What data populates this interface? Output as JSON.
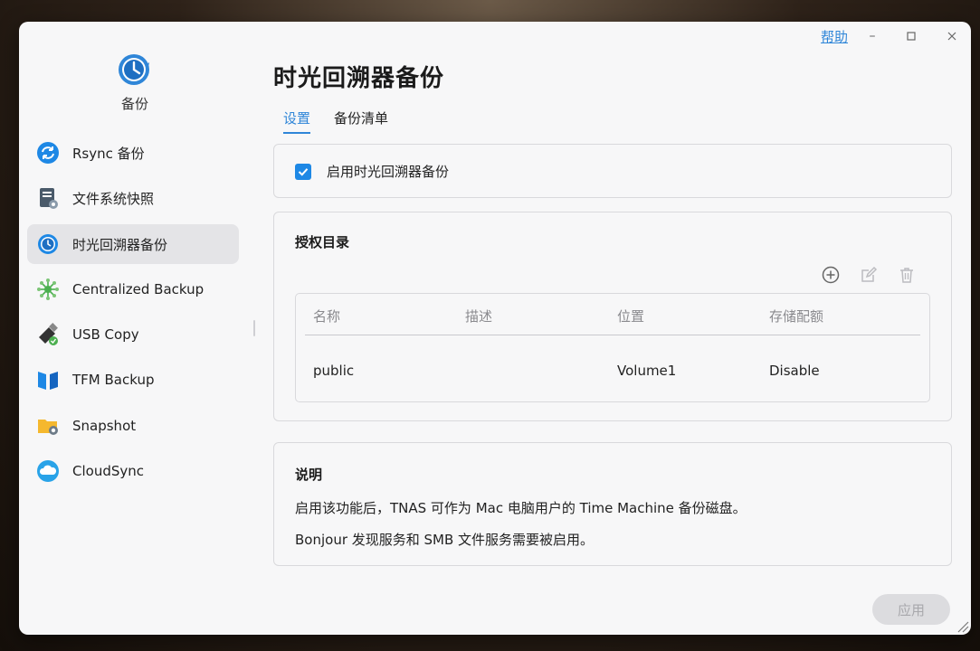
{
  "app": {
    "name": "备份"
  },
  "window": {
    "help": "帮助",
    "minimize": "–",
    "maximize": "□",
    "close": "×"
  },
  "sidebar": {
    "items": [
      {
        "label": "Rsync 备份",
        "icon": "rsync-icon"
      },
      {
        "label": "文件系统快照",
        "icon": "filesystem-snapshot-icon"
      },
      {
        "label": "时光回溯器备份",
        "icon": "time-machine-icon",
        "active": true
      },
      {
        "label": "Centralized Backup",
        "icon": "centralized-backup-icon"
      },
      {
        "label": "USB Copy",
        "icon": "usb-copy-icon"
      },
      {
        "label": "TFM Backup",
        "icon": "tfm-backup-icon"
      },
      {
        "label": "Snapshot",
        "icon": "snapshot-folder-icon"
      },
      {
        "label": "CloudSync",
        "icon": "cloudsync-icon"
      }
    ]
  },
  "main": {
    "title": "时光回溯器备份",
    "tabs": [
      {
        "label": "设置",
        "active": true
      },
      {
        "label": "备份清单",
        "active": false
      }
    ],
    "enable": {
      "checked": true,
      "label": "启用时光回溯器备份"
    },
    "authorized": {
      "title": "授权目录",
      "toolbar": [
        "add-icon",
        "edit-icon",
        "delete-icon"
      ],
      "columns": [
        "名称",
        "描述",
        "位置",
        "存储配额"
      ],
      "rows": [
        {
          "name": "public",
          "description": "",
          "location": "Volume1",
          "quota": "Disable"
        }
      ]
    },
    "notes": {
      "title": "说明",
      "lines": [
        "启用该功能后，TNAS 可作为 Mac 电脑用户的 Time Machine 备份磁盘。",
        "Bonjour 发现服务和 SMB 文件服务需要被启用。"
      ]
    },
    "apply_label": "应用"
  },
  "colors": {
    "accent": "#2f86d8",
    "checkbox": "#1e88e5",
    "active_nav": "#e4e4e7"
  }
}
